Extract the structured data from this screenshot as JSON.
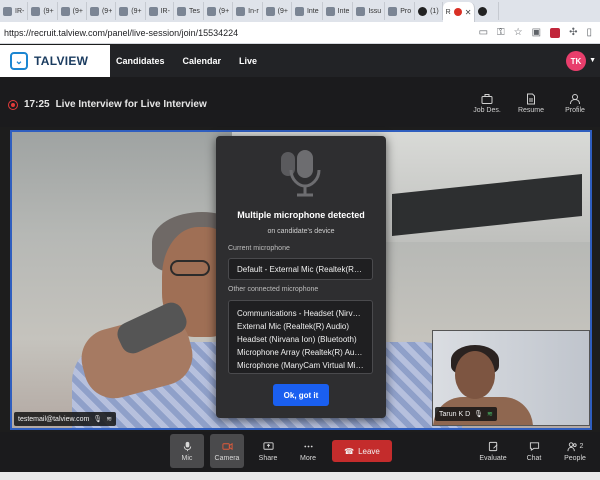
{
  "browser": {
    "tabs": [
      {
        "label": "IR-"
      },
      {
        "label": "(9+"
      },
      {
        "label": "(9+"
      },
      {
        "label": "(9+"
      },
      {
        "label": "(9+"
      },
      {
        "label": "IR-"
      },
      {
        "label": "Tes"
      },
      {
        "label": "(9+"
      },
      {
        "label": "In-r"
      },
      {
        "label": "(9+"
      },
      {
        "label": "Inte"
      },
      {
        "label": "Inte"
      },
      {
        "label": "Issu"
      },
      {
        "label": "Pro"
      },
      {
        "label": "(1)"
      },
      {
        "label": "R"
      }
    ],
    "url": "https://recruit.talview.com/panel/live-session/join/15534224"
  },
  "app": {
    "brand": "TALVIEW",
    "nav": [
      "Candidates",
      "Calendar",
      "Live"
    ],
    "avatar_initials": "TK"
  },
  "session": {
    "time": "17:25",
    "title": "Live Interview for Live Interview",
    "tools": [
      "Job Des.",
      "Resume",
      "Profile"
    ]
  },
  "video": {
    "candidate_email": "testemail@talview.com",
    "self_name": "Tarun K D"
  },
  "modal": {
    "title": "Multiple microphone detected",
    "subtitle": "on candidate's device",
    "current_label": "Current microphone",
    "current_value": "Default - External Mic (Realtek(R) Audio)",
    "other_label": "Other connected microphone",
    "others": [
      "Communications - Headset (Nirvana Ion)",
      "External Mic (Realtek(R) Audio)",
      "Headset (Nirvana Ion) (Bluetooth)",
      "Microphone Array (Realtek(R) Audio)",
      "Microphone (ManyCam Virtual Microphone)"
    ],
    "ok_label": "Ok, got it"
  },
  "controls": {
    "mic": "Mic",
    "camera": "Camera",
    "share": "Share",
    "more": "More",
    "leave": "Leave",
    "evaluate": "Evaluate",
    "chat": "Chat",
    "people": "People",
    "people_count": "2"
  },
  "colors": {
    "accent": "#1a5ff0",
    "leave": "#c42c2c",
    "avatar": "#e83e6c",
    "video_border": "#2f5ebf"
  }
}
